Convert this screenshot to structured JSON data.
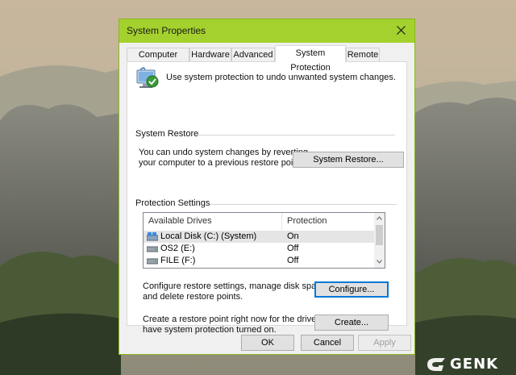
{
  "window": {
    "title": "System Properties",
    "accent": "#a4d12d"
  },
  "tabs": [
    {
      "label": "Computer Name"
    },
    {
      "label": "Hardware"
    },
    {
      "label": "Advanced"
    },
    {
      "label": "System Protection",
      "active": true
    },
    {
      "label": "Remote"
    }
  ],
  "intro": {
    "text": "Use system protection to undo unwanted system changes.",
    "icon": "system-protection-icon"
  },
  "system_restore": {
    "group_title": "System Restore",
    "description_line1": "You can undo system changes by reverting",
    "description_line2": "your computer to a previous restore point.",
    "button_label": "System Restore..."
  },
  "protection_settings": {
    "group_title": "Protection Settings",
    "columns": [
      "Available Drives",
      "Protection"
    ],
    "drives": [
      {
        "name": "Local Disk (C:) (System)",
        "protection": "On",
        "selected": true,
        "icon": "system-drive-icon"
      },
      {
        "name": "OS2 (E:)",
        "protection": "Off",
        "icon": "drive-icon"
      },
      {
        "name": "FILE (F:)",
        "protection": "Off",
        "icon": "drive-icon"
      }
    ],
    "configure_text_line1": "Configure restore settings, manage disk space,",
    "configure_text_line2": "and delete restore points.",
    "configure_button": "Configure...",
    "create_text_line1": "Create a restore point right now for the drives that",
    "create_text_line2": "have system protection turned on.",
    "create_button": "Create..."
  },
  "footer": {
    "ok": "OK",
    "cancel": "Cancel",
    "apply": "Apply"
  },
  "watermark": {
    "text": "GENK"
  }
}
